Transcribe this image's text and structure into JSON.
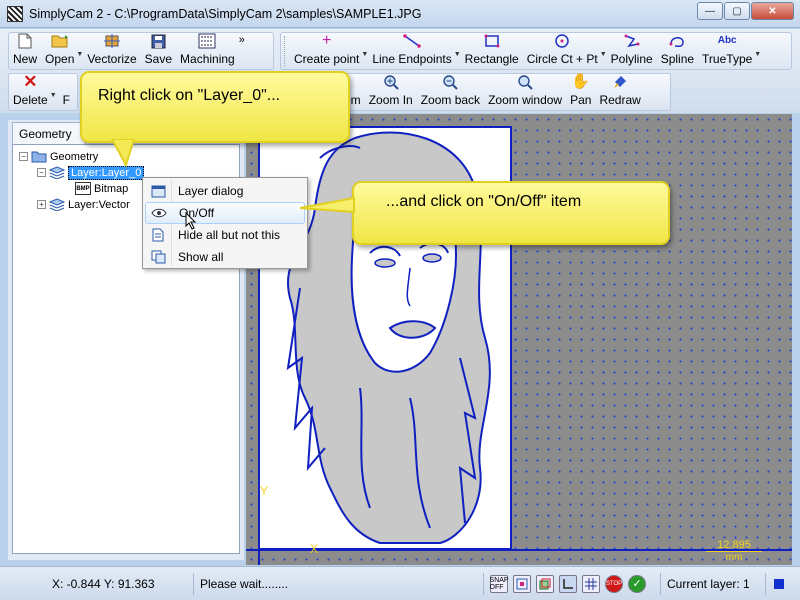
{
  "window": {
    "title": "SimplyCam 2 - C:\\ProgramData\\SimplyCam 2\\samples\\SAMPLE1.JPG",
    "minimize": "—",
    "maximize": "▢",
    "close": "✕"
  },
  "toolbar1": {
    "new": "New",
    "open": "Open",
    "vectorize": "Vectorize",
    "save": "Save",
    "machining": "Machining",
    "more": "»"
  },
  "toolbar2": {
    "create_point": "Create point",
    "line_endpoints": "Line Endpoints",
    "rectangle": "Rectangle",
    "circle": "Circle Ct + Pt",
    "polyline": "Polyline",
    "spline": "Spline",
    "truetype": "TrueType",
    "truetype_icon": "Abc"
  },
  "toolbar3": {
    "delete": "Delete",
    "f_partial": "F"
  },
  "toolbar4": {
    "zoom_partial": "Zoom",
    "zoom_in": "Zoom In",
    "zoom_back": "Zoom back",
    "zoom_window": "Zoom window",
    "pan": "Pan",
    "redraw": "Redraw"
  },
  "panel": {
    "tab": "Geometry",
    "tree": [
      {
        "label": "Geometry",
        "exp": "−"
      },
      {
        "label": "Layer:Layer_0",
        "exp": "−"
      },
      {
        "label": "Bitmap",
        "exp": ""
      },
      {
        "label": "Layer:Vector",
        "exp": "+"
      }
    ]
  },
  "context_menu": {
    "items": [
      "Layer dialog",
      "On/Off",
      "Hide all but not this",
      "Show all"
    ]
  },
  "callouts": {
    "first": "Right click on \"Layer_0\"...",
    "second": "...and click on \"On/Off\" item"
  },
  "canvas": {
    "dimension": "12.895",
    "dimension_unit": "mm",
    "axis_y": "Y",
    "axis_x": "X"
  },
  "status": {
    "coords": "X: -0.844 Y: 91.363",
    "message": "Please wait........",
    "snap_off": "SNAP OFF",
    "stop": "STOP",
    "current_layer": "Current layer: 1"
  },
  "colors": {
    "vector_line": "#1020c0",
    "fill_gray": "#c8c8c8",
    "callout": "#fff37a",
    "dimension": "#f2d21a"
  }
}
